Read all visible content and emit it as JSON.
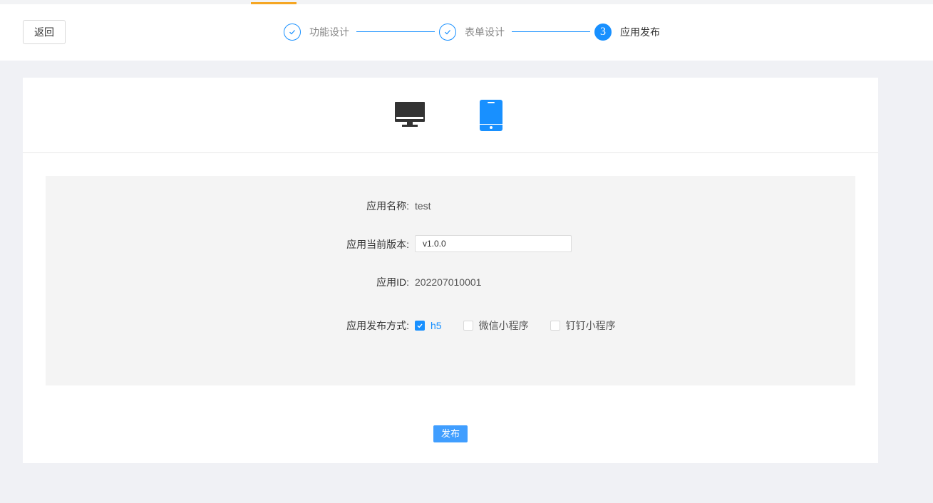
{
  "header": {
    "back_label": "返回",
    "steps": [
      {
        "label": "功能设计",
        "status": "done"
      },
      {
        "label": "表单设计",
        "status": "done"
      },
      {
        "label": "应用发布",
        "status": "active",
        "number": "3"
      }
    ]
  },
  "devices": [
    {
      "name": "desktop",
      "icon": "monitor-icon",
      "selected": false
    },
    {
      "name": "mobile",
      "icon": "phone-icon",
      "selected": true
    }
  ],
  "form": {
    "app_name_label": "应用名称:",
    "app_name_value": "test",
    "version_label": "应用当前版本:",
    "version_value": "v1.0.0",
    "app_id_label": "应用ID:",
    "app_id_value": "202207010001",
    "publish_mode_label": "应用发布方式:",
    "publish_modes": [
      {
        "label": "h5",
        "checked": true
      },
      {
        "label": "微信小程序",
        "checked": false
      },
      {
        "label": "钉钉小程序",
        "checked": false
      }
    ]
  },
  "publish_button": "发布",
  "colors": {
    "primary": "#1890ff",
    "button": "#409eff",
    "accent": "#f5a623",
    "page_bg": "#f0f1f5"
  }
}
